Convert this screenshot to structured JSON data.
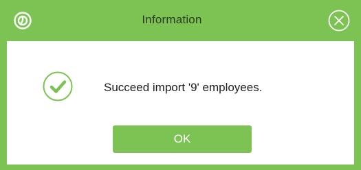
{
  "dialog": {
    "title": "Information",
    "message": "Succeed import '9' employees.",
    "ok_label": "OK"
  },
  "icons": {
    "app": "app-logo-icon",
    "close": "close-icon",
    "status": "success-check-icon"
  },
  "colors": {
    "accent": "#7cc353",
    "title_text": "#2e3a22",
    "body_text": "#1e1e1e",
    "button_text": "#ffffff"
  }
}
